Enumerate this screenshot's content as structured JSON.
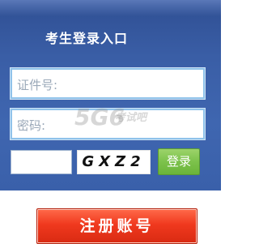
{
  "login": {
    "title": "考生登录入口",
    "username_placeholder": "证件号:",
    "password_placeholder": "密码:",
    "captcha_code": "GXZ2",
    "login_label": "登录"
  },
  "register": {
    "label": "注册账号"
  },
  "watermark": {
    "logo": "5G6",
    "text": "考试吧"
  },
  "colors": {
    "panel_blue": "#3f66b0",
    "login_green": "#7cc24b",
    "register_red": "#f0391e"
  }
}
